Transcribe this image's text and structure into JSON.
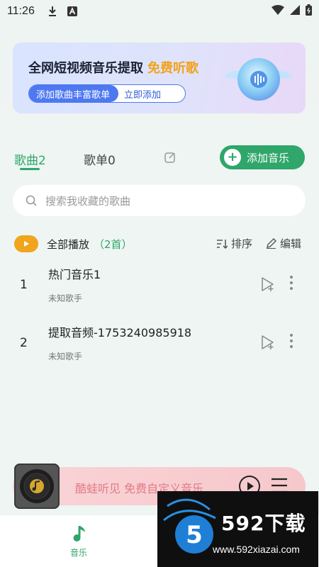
{
  "status_bar": {
    "time": "11:26"
  },
  "banner": {
    "title": "全网短视频音乐提取",
    "highlight": "免费听歌",
    "pill_left": "添加歌曲丰富歌单",
    "pill_right": "立即添加"
  },
  "tabs": {
    "songs": "歌曲2",
    "playlists": "歌单0",
    "add_music": "添加音乐"
  },
  "search": {
    "placeholder": "搜索我收藏的歌曲"
  },
  "play_all": {
    "label": "全部播放",
    "count": "（2首）",
    "sort": "排序",
    "edit": "编辑"
  },
  "songs": [
    {
      "num": "1",
      "title": "热门音乐1",
      "artist": "未知歌手"
    },
    {
      "num": "2",
      "title": "提取音频-1753240985918",
      "artist": "未知歌手"
    }
  ],
  "player": {
    "text": "酷蛙听见 免费自定义音乐"
  },
  "bottom_nav": {
    "music": "音乐"
  },
  "watermark": {
    "brand_num": "5",
    "brand": "592下载",
    "url": "www.592xiazai.com"
  },
  "colors": {
    "accent": "#2fa66a",
    "orange": "#f0a51c",
    "blue": "#4d78f0"
  }
}
